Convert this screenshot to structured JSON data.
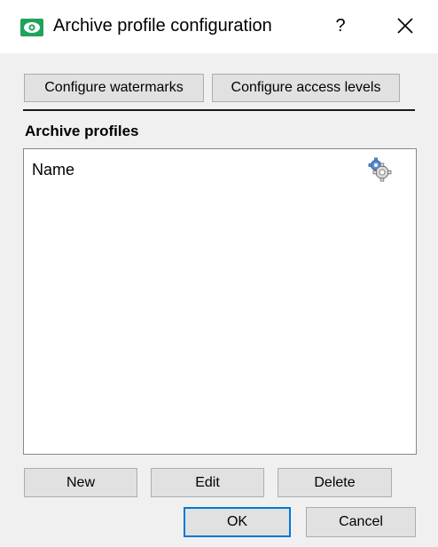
{
  "window": {
    "title": "Archive profile configuration",
    "help_label": "?",
    "icons": {
      "app": "eye-icon",
      "close": "close-icon",
      "settings": "gear-icon"
    },
    "colors": {
      "app_icon": "#1fa35a",
      "default_button_border": "#0078d7"
    }
  },
  "toolbar": {
    "configure_watermarks_label": "Configure watermarks",
    "configure_access_levels_label": "Configure access levels"
  },
  "profiles": {
    "section_label": "Archive profiles",
    "columns": [
      "Name"
    ],
    "rows": []
  },
  "actions": {
    "new_label": "New",
    "edit_label": "Edit",
    "delete_label": "Delete"
  },
  "footer": {
    "ok_label": "OK",
    "cancel_label": "Cancel"
  }
}
